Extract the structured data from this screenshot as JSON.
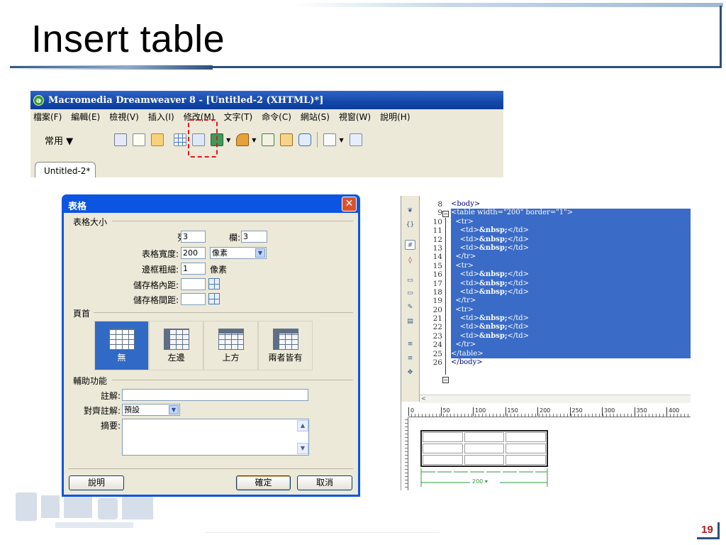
{
  "slide": {
    "title": "Insert table",
    "page_number": "19",
    "accent_color": "#2f4f7c",
    "page_number_color": "#b5181f"
  },
  "dw": {
    "window_title": "Macromedia Dreamweaver 8 - [Untitled-2 (XHTML)*]",
    "menus": [
      "檔案(F)",
      "編輯(E)",
      "檢視(V)",
      "插入(I)",
      "修改(M)",
      "文字(T)",
      "命令(C)",
      "網站(S)",
      "視窗(W)",
      "說明(H)"
    ],
    "insert_bar_category": "常用 ▼",
    "document_tab": "Untitled-2*",
    "toolbar_icons": [
      "hyperlink-icon",
      "email-link-icon",
      "named-anchor-icon",
      "table-icon",
      "layer-icon",
      "image-icon",
      "media-icon",
      "date-icon",
      "comment-icon",
      "template-icon",
      "tag-chooser-icon"
    ]
  },
  "dialog": {
    "title": "表格",
    "close_glyph": "✕",
    "group_size": "表格大小",
    "rows_label": "列:",
    "rows_value": "3",
    "cols_label": "欄:",
    "cols_value": "3",
    "width_label": "表格寬度:",
    "width_value": "200",
    "width_unit": "像素",
    "border_label": "邊框粗細:",
    "border_value": "1",
    "border_unit": "像素",
    "padding_label": "儲存格內距:",
    "spacing_label": "儲存格間距:",
    "group_header": "頁首",
    "header_options": [
      "無",
      "左邊",
      "上方",
      "兩者皆有"
    ],
    "group_access": "輔助功能",
    "caption_label": "註解:",
    "align_caption_label": "對齊註解:",
    "align_caption_value": "預設",
    "summary_label": "摘要:",
    "help_button": "說明",
    "ok_button": "確定",
    "cancel_button": "取消"
  },
  "code": {
    "line_numbers": [
      "8",
      "9",
      "10",
      "11",
      "12",
      "13",
      "14",
      "15",
      "16",
      "17",
      "18",
      "19",
      "20",
      "21",
      "22",
      "23",
      "24",
      "25",
      "26"
    ],
    "lines": [
      {
        "text": "<body>",
        "hl": false
      },
      {
        "text": "<table width=\"200\" border=\"1\">",
        "hl": true
      },
      {
        "text": "  <tr>",
        "hl": true
      },
      {
        "text": "    <td>&nbsp;</td>",
        "hl": true
      },
      {
        "text": "    <td>&nbsp;</td>",
        "hl": true
      },
      {
        "text": "    <td>&nbsp;</td>",
        "hl": true
      },
      {
        "text": "  </tr>",
        "hl": true
      },
      {
        "text": "  <tr>",
        "hl": true
      },
      {
        "text": "    <td>&nbsp;</td>",
        "hl": true
      },
      {
        "text": "    <td>&nbsp;</td>",
        "hl": true
      },
      {
        "text": "    <td>&nbsp;</td>",
        "hl": true
      },
      {
        "text": "  </tr>",
        "hl": true
      },
      {
        "text": "  <tr>",
        "hl": true
      },
      {
        "text": "    <td>&nbsp;</td>",
        "hl": true
      },
      {
        "text": "    <td>&nbsp;</td>",
        "hl": true
      },
      {
        "text": "    <td>&nbsp;</td>",
        "hl": true
      },
      {
        "text": "  </tr>",
        "hl": true
      },
      {
        "text": "</table>",
        "hl": true
      },
      {
        "text": "</body>",
        "hl": false
      }
    ],
    "highlight_color": "#3a6bc6",
    "ruler_marks": [
      "0",
      "50",
      "100",
      "150",
      "200",
      "250",
      "300",
      "350",
      "400"
    ],
    "table_width_label": "200 ▾"
  }
}
